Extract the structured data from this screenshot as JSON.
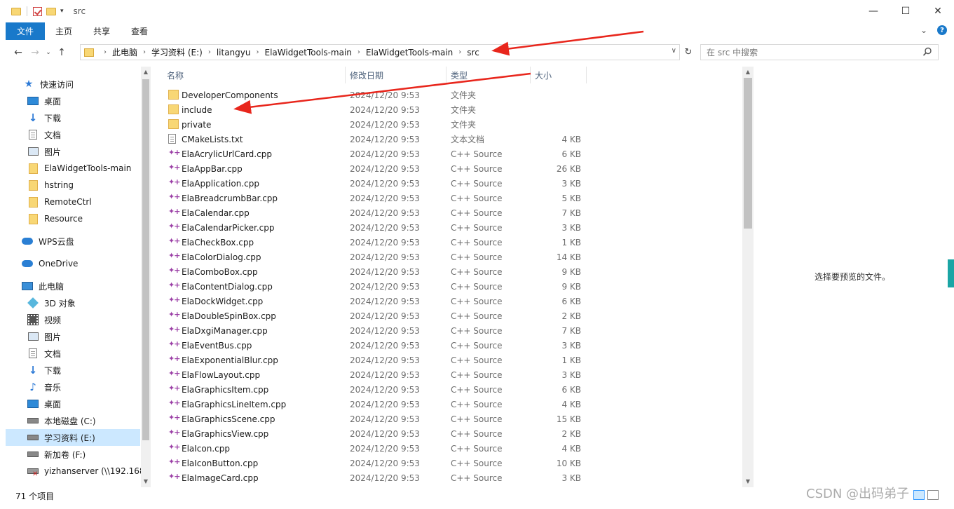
{
  "window": {
    "title": "src",
    "controls": {
      "minimize": "—",
      "maximize": "☐",
      "close": "✕"
    }
  },
  "ribbon": {
    "tabs": [
      "文件",
      "主页",
      "共享",
      "查看"
    ],
    "expand": "⌄",
    "help": "?"
  },
  "address": {
    "crumbs": [
      "此电脑",
      "学习资料 (E:)",
      "litangyu",
      "ElaWidgetTools-main",
      "ElaWidgetTools-main",
      "src"
    ]
  },
  "search": {
    "placeholder": "在 src 中搜索"
  },
  "nav": {
    "quick_access": "快速访问",
    "items": [
      {
        "label": "桌面",
        "icon": "desktop-icon",
        "pinned": true
      },
      {
        "label": "下载",
        "icon": "download-icon",
        "pinned": true
      },
      {
        "label": "文档",
        "icon": "document-icon",
        "pinned": true
      },
      {
        "label": "图片",
        "icon": "picture-icon",
        "pinned": true
      },
      {
        "label": "ElaWidgetTools-main",
        "icon": "folder-icon",
        "pinned": false
      },
      {
        "label": "hstring",
        "icon": "folder-icon",
        "pinned": false
      },
      {
        "label": "RemoteCtrl",
        "icon": "folder-icon",
        "pinned": false
      },
      {
        "label": "Resource",
        "icon": "folder-icon",
        "pinned": false
      }
    ],
    "wps": "WPS云盘",
    "onedrive": "OneDrive",
    "this_pc": "此电脑",
    "pc_items": [
      {
        "label": "3D 对象",
        "icon": "3d-objects-icon"
      },
      {
        "label": "视频",
        "icon": "video-icon"
      },
      {
        "label": "图片",
        "icon": "picture-icon"
      },
      {
        "label": "文档",
        "icon": "document-icon"
      },
      {
        "label": "下载",
        "icon": "download-icon"
      },
      {
        "label": "音乐",
        "icon": "music-icon"
      },
      {
        "label": "桌面",
        "icon": "desktop-icon"
      },
      {
        "label": "本地磁盘 (C:)",
        "icon": "drive-icon"
      },
      {
        "label": "学习资料 (E:)",
        "icon": "drive-icon",
        "selected": true
      },
      {
        "label": "新加卷 (F:)",
        "icon": "drive-icon"
      },
      {
        "label": "yizhanserver (\\\\192.168.",
        "icon": "network-drive-icon"
      }
    ]
  },
  "columns": {
    "name": "名称",
    "date": "修改日期",
    "type": "类型",
    "size": "大小"
  },
  "files": [
    {
      "name": "DeveloperComponents",
      "date": "2024/12/20 9:53",
      "type": "文件夹",
      "size": "",
      "kind": "folder"
    },
    {
      "name": "include",
      "date": "2024/12/20 9:53",
      "type": "文件夹",
      "size": "",
      "kind": "folder"
    },
    {
      "name": "private",
      "date": "2024/12/20 9:53",
      "type": "文件夹",
      "size": "",
      "kind": "folder"
    },
    {
      "name": "CMakeLists.txt",
      "date": "2024/12/20 9:53",
      "type": "文本文档",
      "size": "4 KB",
      "kind": "txt"
    },
    {
      "name": "ElaAcrylicUrlCard.cpp",
      "date": "2024/12/20 9:53",
      "type": "C++ Source",
      "size": "6 KB",
      "kind": "cpp"
    },
    {
      "name": "ElaAppBar.cpp",
      "date": "2024/12/20 9:53",
      "type": "C++ Source",
      "size": "26 KB",
      "kind": "cpp"
    },
    {
      "name": "ElaApplication.cpp",
      "date": "2024/12/20 9:53",
      "type": "C++ Source",
      "size": "3 KB",
      "kind": "cpp"
    },
    {
      "name": "ElaBreadcrumbBar.cpp",
      "date": "2024/12/20 9:53",
      "type": "C++ Source",
      "size": "5 KB",
      "kind": "cpp"
    },
    {
      "name": "ElaCalendar.cpp",
      "date": "2024/12/20 9:53",
      "type": "C++ Source",
      "size": "7 KB",
      "kind": "cpp"
    },
    {
      "name": "ElaCalendarPicker.cpp",
      "date": "2024/12/20 9:53",
      "type": "C++ Source",
      "size": "3 KB",
      "kind": "cpp"
    },
    {
      "name": "ElaCheckBox.cpp",
      "date": "2024/12/20 9:53",
      "type": "C++ Source",
      "size": "1 KB",
      "kind": "cpp"
    },
    {
      "name": "ElaColorDialog.cpp",
      "date": "2024/12/20 9:53",
      "type": "C++ Source",
      "size": "14 KB",
      "kind": "cpp"
    },
    {
      "name": "ElaComboBox.cpp",
      "date": "2024/12/20 9:53",
      "type": "C++ Source",
      "size": "9 KB",
      "kind": "cpp"
    },
    {
      "name": "ElaContentDialog.cpp",
      "date": "2024/12/20 9:53",
      "type": "C++ Source",
      "size": "9 KB",
      "kind": "cpp"
    },
    {
      "name": "ElaDockWidget.cpp",
      "date": "2024/12/20 9:53",
      "type": "C++ Source",
      "size": "6 KB",
      "kind": "cpp"
    },
    {
      "name": "ElaDoubleSpinBox.cpp",
      "date": "2024/12/20 9:53",
      "type": "C++ Source",
      "size": "2 KB",
      "kind": "cpp"
    },
    {
      "name": "ElaDxgiManager.cpp",
      "date": "2024/12/20 9:53",
      "type": "C++ Source",
      "size": "7 KB",
      "kind": "cpp"
    },
    {
      "name": "ElaEventBus.cpp",
      "date": "2024/12/20 9:53",
      "type": "C++ Source",
      "size": "3 KB",
      "kind": "cpp"
    },
    {
      "name": "ElaExponentialBlur.cpp",
      "date": "2024/12/20 9:53",
      "type": "C++ Source",
      "size": "1 KB",
      "kind": "cpp"
    },
    {
      "name": "ElaFlowLayout.cpp",
      "date": "2024/12/20 9:53",
      "type": "C++ Source",
      "size": "3 KB",
      "kind": "cpp"
    },
    {
      "name": "ElaGraphicsItem.cpp",
      "date": "2024/12/20 9:53",
      "type": "C++ Source",
      "size": "6 KB",
      "kind": "cpp"
    },
    {
      "name": "ElaGraphicsLineItem.cpp",
      "date": "2024/12/20 9:53",
      "type": "C++ Source",
      "size": "4 KB",
      "kind": "cpp"
    },
    {
      "name": "ElaGraphicsScene.cpp",
      "date": "2024/12/20 9:53",
      "type": "C++ Source",
      "size": "15 KB",
      "kind": "cpp"
    },
    {
      "name": "ElaGraphicsView.cpp",
      "date": "2024/12/20 9:53",
      "type": "C++ Source",
      "size": "2 KB",
      "kind": "cpp"
    },
    {
      "name": "ElaIcon.cpp",
      "date": "2024/12/20 9:53",
      "type": "C++ Source",
      "size": "4 KB",
      "kind": "cpp"
    },
    {
      "name": "ElaIconButton.cpp",
      "date": "2024/12/20 9:53",
      "type": "C++ Source",
      "size": "10 KB",
      "kind": "cpp"
    },
    {
      "name": "ElaImageCard.cpp",
      "date": "2024/12/20 9:53",
      "type": "C++ Source",
      "size": "3 KB",
      "kind": "cpp"
    }
  ],
  "preview": {
    "message": "选择要预览的文件。"
  },
  "status": {
    "count": "71 个项目"
  },
  "watermark": "CSDN @出码弟子",
  "colors": {
    "accent": "#1979ca",
    "selection": "#cce8ff",
    "annotation": "#e8261c",
    "cpp_icon": "#9b3fa6",
    "folder": "#f8d775"
  }
}
